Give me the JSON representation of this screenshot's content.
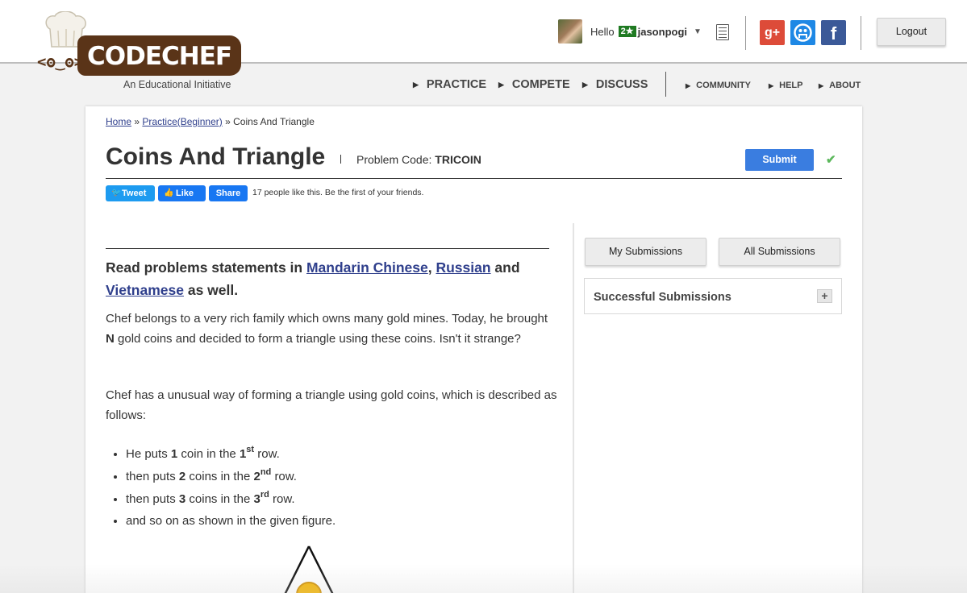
{
  "header": {
    "brand": "CODECHEF",
    "tagline": "An Educational Initiative",
    "user": {
      "greeting": "Hello",
      "rating_badge": "2★",
      "username": "jasonpogi"
    },
    "social": [
      {
        "name": "google-plus-icon",
        "glyph": "g+",
        "color": "#dd4b39"
      },
      {
        "name": "github-icon",
        "glyph": "◎",
        "color": "#1e88e5"
      },
      {
        "name": "facebook-icon",
        "glyph": "f",
        "color": "#3b5998"
      }
    ],
    "logout_label": "Logout",
    "nav_main": [
      "PRACTICE",
      "COMPETE",
      "DISCUSS"
    ],
    "nav_sub": [
      "COMMUNITY",
      "HELP",
      "ABOUT"
    ]
  },
  "breadcrumb": {
    "home": "Home",
    "sep1": "»",
    "practice": "Practice(Beginner)",
    "sep2": "»",
    "current": "Coins And Triangle"
  },
  "problem": {
    "title": "Coins And Triangle",
    "code_label": "Problem Code:",
    "code": "TRICOIN",
    "submit_label": "Submit",
    "status_icon": "✔"
  },
  "social_bar": {
    "tweet": "Tweet",
    "like": "Like",
    "share": "Share",
    "likes_text": "17 people like this. Be the first of your friends."
  },
  "statement": {
    "lang_prefix": "Read problems statements in",
    "lang_mandarin": "Mandarin Chinese",
    "lang_comma": ",",
    "lang_russian": "Russian",
    "lang_and": "and",
    "lang_vietnamese": "Vietnamese",
    "lang_suffix": "as well.",
    "p1_a": "Chef belongs to a very rich family which owns many gold mines. Today, he brought",
    "p1_n": "N",
    "p1_b": "gold coins and decided to form a triangle using these coins. Isn't it strange?",
    "p2": "Chef has a unusual way of forming a triangle using gold coins, which is described as follows:",
    "rules": [
      {
        "pre": "He puts",
        "num": "1",
        "mid": "coin in the",
        "ord": "1",
        "sup": "st",
        "post": "row."
      },
      {
        "pre": "then puts",
        "num": "2",
        "mid": "coins in the",
        "ord": "2",
        "sup": "nd",
        "post": "row."
      },
      {
        "pre": "then puts",
        "num": "3",
        "mid": "coins in the",
        "ord": "3",
        "sup": "rd",
        "post": "row."
      }
    ],
    "rule_last": "and so on as shown in the given figure."
  },
  "sidebar": {
    "my_submissions": "My Submissions",
    "all_submissions": "All Submissions",
    "successful_submissions": "Successful Submissions",
    "expand_icon": "+"
  }
}
